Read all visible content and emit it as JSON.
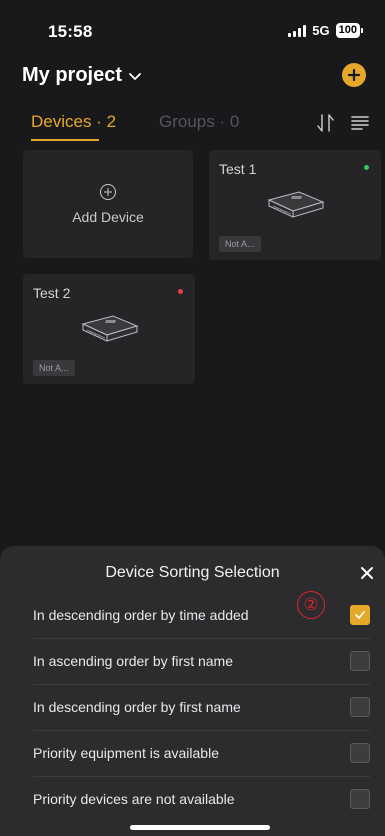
{
  "status_bar": {
    "time": "15:58",
    "network": "5G",
    "battery": "100"
  },
  "header": {
    "project_title": "My project"
  },
  "tabs": {
    "devices": "Devices · 2",
    "groups": "Groups · 0"
  },
  "grid": {
    "add_device_label": "Add Device",
    "devices": [
      {
        "name": "Test 1",
        "badge": "Not A...",
        "status": "online"
      },
      {
        "name": "Test 2",
        "badge": "Not A...",
        "status": "offline"
      }
    ]
  },
  "sheet": {
    "title": "Device Sorting Selection",
    "options": [
      {
        "label": "In descending order by time added",
        "checked": true
      },
      {
        "label": "In ascending order by first name",
        "checked": false
      },
      {
        "label": "In descending order by first name",
        "checked": false
      },
      {
        "label": "Priority equipment is available",
        "checked": false
      },
      {
        "label": "Priority devices are not available",
        "checked": false
      }
    ],
    "annotation": "②"
  },
  "colors": {
    "accent": "#e6a82a",
    "online": "#34c759",
    "offline": "#e04040",
    "background": "#19191b",
    "card": "#252527",
    "sheet": "#2c2c2f"
  }
}
